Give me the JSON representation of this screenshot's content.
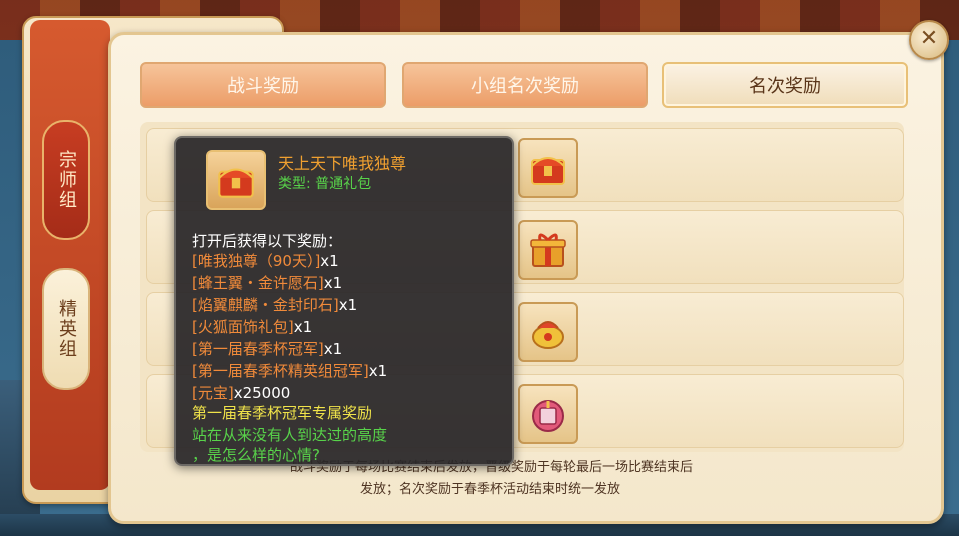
{
  "side_tabs": [
    {
      "label": "宗师组",
      "active": true
    },
    {
      "label": "精英组",
      "active": false
    }
  ],
  "tabs": [
    {
      "label": "战斗奖励",
      "active": false
    },
    {
      "label": "小组名次奖励",
      "active": false
    },
    {
      "label": "名次奖励",
      "active": true
    }
  ],
  "close_icon": "close-icon",
  "reward_slots": [
    {
      "icon": "treasure-chest-icon"
    },
    {
      "icon": "gift-box-icon"
    },
    {
      "icon": "gold-pouch-icon"
    },
    {
      "icon": "lantern-gift-icon"
    }
  ],
  "footnote": {
    "line1": "战斗奖励于每场比赛结束后发放，晋级奖励于每轮最后一场比赛结束后",
    "line2": "发放；名次奖励于春季杯活动结束时统一发放"
  },
  "tooltip": {
    "title": "天上天下唯我独尊",
    "type": "类型: 普通礼包",
    "intro": "打开后获得以下奖励：",
    "items": [
      {
        "name": "[唯我独尊（90天）]",
        "qty": "x1"
      },
      {
        "name": "[蜂王翼・金许愿石]",
        "qty": "x1"
      },
      {
        "name": "[焰翼麒麟・金封印石]",
        "qty": "x1"
      },
      {
        "name": "[火狐面饰礼包]",
        "qty": "x1"
      },
      {
        "name": "[第一届春季杯冠军]",
        "qty": "x1"
      },
      {
        "name": "[第一届春季杯精英组冠军]",
        "qty": "x1"
      },
      {
        "name": "[元宝]",
        "qty": "x25000"
      }
    ],
    "exclusive": "第一届春季杯冠军专属奖励",
    "flavor1": "站在从来没有人到达过的高度",
    "flavor2": "，是怎么样的心情?"
  },
  "colors": {
    "accent_red": "#c44a26",
    "tab_orange": "#ec9d68",
    "item_orange": "#f08a3a",
    "type_green": "#58d34a",
    "exclusive_yellow": "#f0e34a"
  }
}
